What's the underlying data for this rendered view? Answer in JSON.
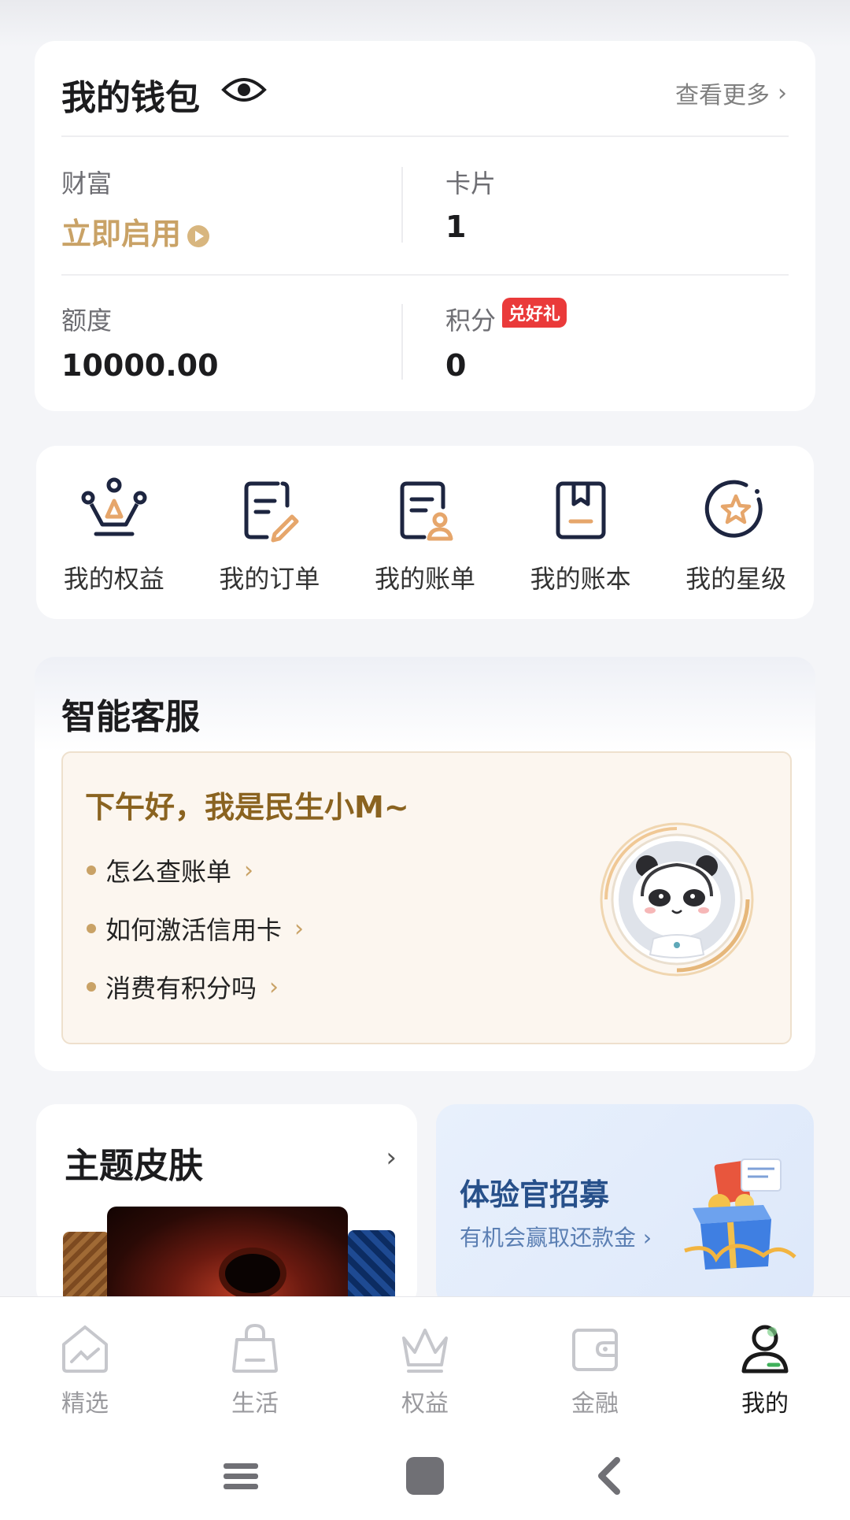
{
  "wallet": {
    "title": "我的钱包",
    "more": "查看更多",
    "wealth": {
      "label": "财富",
      "value": "立即启用"
    },
    "cards": {
      "label": "卡片",
      "value": "1"
    },
    "limit": {
      "label": "额度",
      "value": "10000.00"
    },
    "points": {
      "label": "积分",
      "badge": "兑好礼",
      "value": "0"
    }
  },
  "quick_menu": [
    {
      "label": "我的权益",
      "icon": "crown-icon"
    },
    {
      "label": "我的订单",
      "icon": "order-edit-icon"
    },
    {
      "label": "我的账单",
      "icon": "bill-user-icon"
    },
    {
      "label": "我的账本",
      "icon": "bookmark-icon"
    },
    {
      "label": "我的星级",
      "icon": "star-circle-icon"
    }
  ],
  "service": {
    "title": "智能客服",
    "greeting": "下午好，我是民生小M~",
    "faqs": [
      "怎么查账单",
      "如何激活信用卡",
      "消费有积分吗"
    ]
  },
  "theme": {
    "title": "主题皮肤"
  },
  "recruit": {
    "title": "体验官招募",
    "subtitle": "有机会赢取还款金"
  },
  "tabs": [
    {
      "label": "精选",
      "icon": "home-icon"
    },
    {
      "label": "生活",
      "icon": "bag-icon"
    },
    {
      "label": "权益",
      "icon": "crown-icon"
    },
    {
      "label": "金融",
      "icon": "wallet-icon"
    },
    {
      "label": "我的",
      "icon": "profile-icon",
      "active": true
    }
  ],
  "colors": {
    "gold": "#c9a266",
    "badge_red": "#ea3a3a",
    "navy": "#1d2540",
    "accent_orange": "#e6a66b"
  }
}
